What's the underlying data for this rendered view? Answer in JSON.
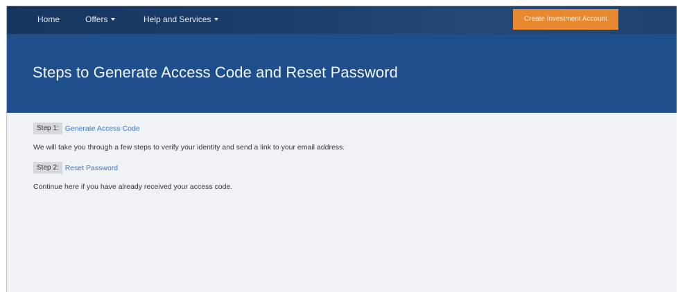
{
  "nav": {
    "home": "Home",
    "offers": "Offers",
    "help": "Help and Services",
    "cta": "Create Investment Account"
  },
  "hero": {
    "title": "Steps to Generate Access Code and Reset Password"
  },
  "steps": [
    {
      "tag": "Step 1:",
      "link": "Generate Access Code",
      "description": "We will take you through a few steps to verify your identity and send a link to your email address."
    },
    {
      "tag": "Step 2:",
      "link": "Reset Password",
      "description": "Continue here if you have already received your access code."
    }
  ],
  "colors": {
    "nav_bg": "#1c3f6c",
    "hero_bg": "#1e4f8c",
    "cta_bg": "#e8882f",
    "link": "#3c79c9",
    "page_bg": "#f0f3f6"
  }
}
